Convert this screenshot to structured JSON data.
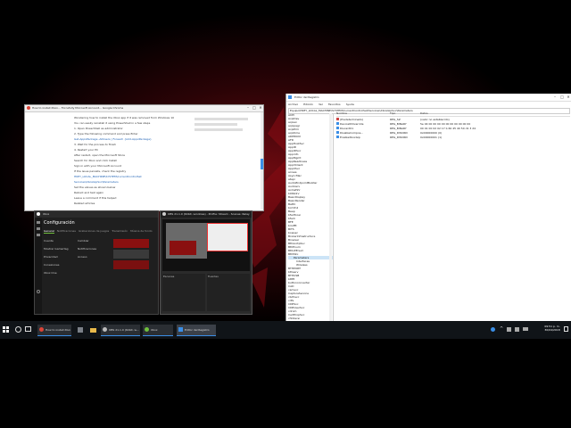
{
  "chrome": {
    "title": "How to install Xbox… Forcefully Microsoft Account… Google Chrome",
    "article_lines": [
      "Wondering how to install the Xbox app if it was removed from Windows 10",
      "You can easily reinstall it using PowerShell in a few steps",
      "1. Open PowerShell as administrator",
      "2. Type the following command and press Enter",
      "Get-AppxPackage -AllUsers | Foreach {Add-AppxPackage}",
      "3. Wait for the process to finish",
      "4. Restart your PC",
      "After restart, open the Microsoft Store",
      "Search for Xbox and click Install",
      "Sign in with your Microsoft Account",
      "If the issue persists, check the registry",
      "HKEY_LOCAL_MACHINE\\SYSTEM\\CurrentControlSet",
      "Services\\XboxGipSvc\\Parameters",
      "Set the values as shown below",
      "Reboot and test again",
      "Leave a comment if this helped",
      "Related articles"
    ]
  },
  "xbox": {
    "title": "Xbox",
    "heading": "Configuración",
    "tabs": [
      "General",
      "Notificaciones",
      "Grabaciones de juegos",
      "Transmisión",
      "Música de fondo"
    ],
    "left_options": [
      "Cuenta",
      "Mostrar Gamertag",
      "Privacidad",
      "Conexiones",
      "Xbox One"
    ],
    "mid_options": [
      "Cambiar",
      "Notificaciones",
      "Acceso"
    ]
  },
  "obs": {
    "title": "OBS 21.1.0 (64bit, windows) - Profile: Stream - Scenes: Relay",
    "scenes": "Escenas",
    "sources": "Fuentes"
  },
  "regedit": {
    "title": "Editor del Registro",
    "menu": [
      "Archivo",
      "Edición",
      "Ver",
      "Favoritos",
      "Ayuda"
    ],
    "address": "Equipo\\HKEY_LOCAL_MACHINE\\SYSTEM\\CurrentControlSet\\Services\\XboxGipSvc\\Parameters",
    "columns": [
      "Nombre",
      "Tipo",
      "Datos"
    ],
    "rows": [
      {
        "name": "(Predeterminado)",
        "type": "REG_SZ",
        "data": "(valor no establecido)"
      },
      {
        "name": "DeviceIDOverride",
        "type": "REG_BINARY",
        "data": "5e 04 00 00 00 00 00 00 00 00 00 00"
      },
      {
        "name": "Discard01",
        "type": "REG_BINARY",
        "data": "00 01 00 02 02 17 b 60 45 40 50 d1 3 d4"
      },
      {
        "name": "DisableCompos...",
        "type": "REG_DWORD",
        "data": "0x00000000 (0)"
      },
      {
        "name": "EnableXboxGip",
        "type": "REG_DWORD",
        "data": "0x00000001 (1)"
      }
    ],
    "tree": [
      "ACPI",
      "AcpiDev",
      "acpiex",
      "acpipagr",
      "AcpiPmi",
      "acpitime",
      "ADP80XX",
      "AFD",
      "AppHostSvc",
      "AppID",
      "AppIDSvc",
      "Appinfo",
      "AppMgmt",
      "AppReadiness",
      "AppVClient",
      "AppXSvc",
      "arcsas",
      "AsyncMac",
      "atapi",
      "AudioEndpointBuilder",
      "Audiosrv",
      "AxInstSV",
      "b06bdrv",
      "BasicDisplay",
      "BasicRender",
      "BattC",
      "bcmfn2",
      "Beep",
      "bfadfcoei",
      "bfadi",
      "BFE",
      "bindflt",
      "BITS",
      "bowser",
      "BrokerInfrastructure",
      "Browser",
      "BthAvctpSvc",
      "BthEnum",
      "BthLEEnum",
      "BthMini",
      "Parameters",
      "Interfaces",
      "Wireless",
      "BTHPORT",
      "bthserv",
      "BTHUSB",
      "bttflt",
      "buttonconverter",
      "CAD",
      "camsvc",
      "CaptureService",
      "cbdhsvc",
      "cdfs",
      "CDPSvc",
      "CDPUserSvc",
      "cdrom",
      "CertPropSvc",
      "cht4iscsi",
      "cht4vbd",
      "CLFS",
      "ClipSVC",
      "CmBatt",
      "CNG",
      "cnghwassist",
      "CompositeBus"
    ],
    "tree_selected": "Parameters"
  },
  "taskbar": {
    "items": [
      "How to install Xbox...",
      "",
      "OBS 21.1.0 (64bit, w...",
      "Xbox",
      "Editor del Registro"
    ],
    "clock_time": "09:51 p. m.",
    "clock_date": "30/04/2018"
  },
  "colors": {
    "taskbar": "#101418",
    "accent": "#3a8ee6",
    "xbox_bg": "#1f1f1f",
    "obs_bg": "#2b2b2b"
  }
}
